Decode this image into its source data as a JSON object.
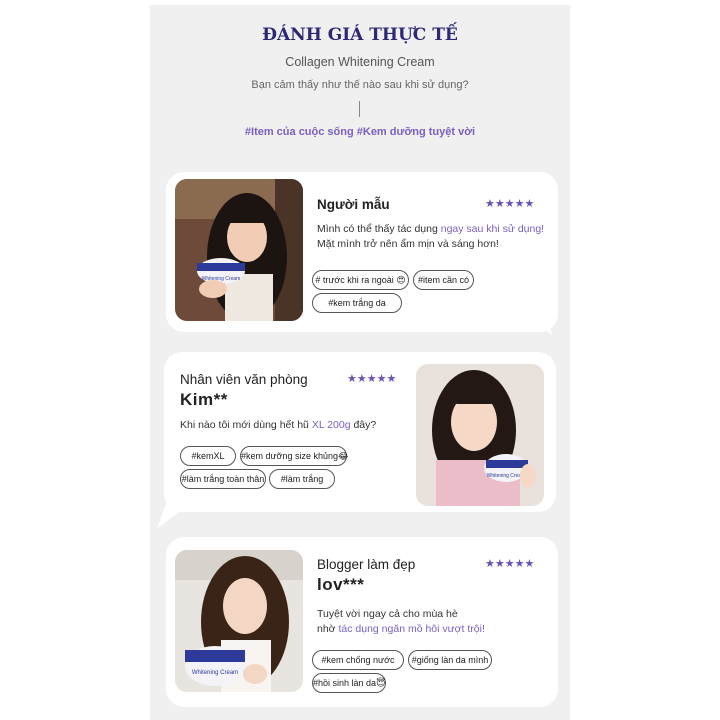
{
  "header": {
    "title": "ĐÁNH GIÁ THỰC TẾ",
    "subtitle": "Collagen Whitening Cream",
    "question": "Bạn cảm thấy như thế nào sau khi sử dụng?",
    "hashtags": "#Item của cuộc sống #Kem dưỡng tuyệt vời"
  },
  "reviews": [
    {
      "name": "Người mẫu",
      "stars": "★★★★★",
      "rating": 5,
      "text_line1_a": "Mình có thể thấy tác dụng ",
      "text_line1_hl": "ngay sau khi sử dụng!",
      "text_line2": "Mặt mình trở nên ẩm mịn và sáng hơn!",
      "jar_label": "Whitening Cream",
      "tags": [
        "# trước khi ra ngoài 😍",
        "#item cần có",
        "#kem trắng da"
      ]
    },
    {
      "name": "Nhân viên văn phòng",
      "handle": "Kim**",
      "stars": "★★★★★",
      "rating": 5,
      "text_a": "Khi nào tôi mới dùng hết hũ ",
      "text_hl": "XL 200g",
      "text_b": " đây?",
      "jar_label": "Whitening Cream",
      "tags": [
        "#kemXL",
        "#kem dưỡng size khủng😂",
        "#làm trắng toàn thân",
        "#làm trắng"
      ]
    },
    {
      "name": "Blogger làm đẹp",
      "handle": "lov***",
      "stars": "★★★★★",
      "rating": 5,
      "text_line1": "Tuyệt vời ngay cả cho mùa hè",
      "text_line2_a": "nhờ ",
      "text_line2_hl": "tác dụng ngăn mồ hôi vượt trội!",
      "jar_label": "Whitening Cream",
      "tags": [
        "#kem chống nước",
        "#giống làn da mình",
        "#hồi sinh làn da😇"
      ]
    }
  ],
  "colors": {
    "title": "#2c2873",
    "accent": "#7b5fc0",
    "stars": "#6a52b3",
    "page_bg": "#f0f0f0",
    "card_bg": "#ffffff"
  }
}
